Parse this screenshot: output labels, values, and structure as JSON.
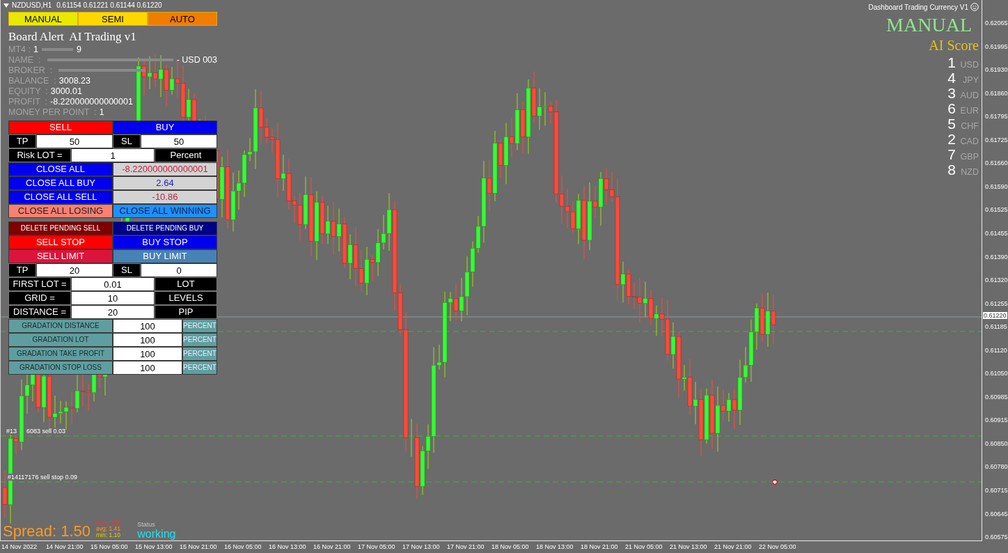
{
  "chart_header": {
    "symbol": "NZDUSD,H1",
    "quotes": "0.61154 0.61221 0.61144 0.61220"
  },
  "modes": [
    {
      "label": "MANUAL",
      "color": "#e8e800"
    },
    {
      "label": "SEMI",
      "color": "#ffd700"
    },
    {
      "label": "AUTO",
      "color": "#ee7d00"
    }
  ],
  "title": "Board Alert  AI Trading v1",
  "account": [
    {
      "label": "MT4 :",
      "prefix": "1",
      "redacted": true,
      "value": "9"
    },
    {
      "label": "NAME  :",
      "redacted": true,
      "value": "- USD 003"
    },
    {
      "label": "BROKER  :",
      "redacted": true
    },
    {
      "label": "BALANCE  :",
      "value": "3008.23"
    },
    {
      "label": "EQUITY  :",
      "value": "3000.01"
    },
    {
      "label": "PROFIT  :",
      "value": "-8.220000000000001"
    },
    {
      "label": "MONEY PER POINT  :",
      "value": "1"
    }
  ],
  "order_panel": [
    {
      "rows": [
        {
          "kind": "pair",
          "left": {
            "kind": "sell",
            "text": "SELL"
          },
          "right": {
            "kind": "buy",
            "text": "BUY"
          }
        },
        {
          "kind": "tp-sl",
          "tp_label": "TP",
          "tp": "50",
          "sl_label": "SL",
          "sl": "50"
        },
        {
          "kind": "setting",
          "label": "Risk LOT =",
          "value": "1",
          "unit": "Percent"
        },
        {
          "kind": "pair",
          "left": {
            "kind": "close",
            "text": "CLOSE ALL"
          },
          "right": {
            "kind": "readout",
            "text": "-8.220000000000001",
            "color": "#c8203c"
          }
        },
        {
          "kind": "pair",
          "left": {
            "kind": "close",
            "text": "CLOSE ALL BUY"
          },
          "right": {
            "kind": "readout",
            "text": "2.64",
            "color": "#2020c0"
          }
        },
        {
          "kind": "pair",
          "left": {
            "kind": "close",
            "text": "CLOSE ALL SELL"
          },
          "right": {
            "kind": "readout",
            "text": "-10.86",
            "color": "#c8203c"
          }
        },
        {
          "kind": "pair",
          "left": {
            "kind": "losing",
            "text": "CLOSE ALL LOSING"
          },
          "right": {
            "kind": "winning",
            "text": "CLOSE ALL WINNING"
          }
        }
      ]
    },
    {
      "rows": [
        {
          "kind": "pair",
          "left": {
            "kind": "delete-sell",
            "text": "DELETE PENDING SELL"
          },
          "right": {
            "kind": "delete-buy",
            "text": "DELETE PENDING BUY"
          }
        },
        {
          "kind": "pair",
          "left": {
            "kind": "sell",
            "text": "SELL STOP"
          },
          "right": {
            "kind": "buy",
            "text": "BUY STOP"
          }
        },
        {
          "kind": "pair",
          "left": {
            "kind": "sell-limit",
            "text": "SELL LIMIT"
          },
          "right": {
            "kind": "buy-limit",
            "text": "BUY LIMIT"
          }
        },
        {
          "kind": "tp-sl",
          "tp_label": "TP",
          "tp": "20",
          "sl_label": "SL",
          "sl": "0"
        },
        {
          "kind": "setting",
          "label": "FIRST LOT =",
          "value": "0.01",
          "unit": "LOT"
        },
        {
          "kind": "setting",
          "label": "GRID =",
          "value": "10",
          "unit": "LEVELS"
        },
        {
          "kind": "setting",
          "label": "DISTANCE =",
          "value": "20",
          "unit": "PIP"
        },
        {
          "kind": "gradation",
          "label": "GRADATION DISTANCE",
          "value": "100",
          "unit": "PERCENT"
        },
        {
          "kind": "gradation",
          "label": "GRADATION LOT",
          "value": "100",
          "unit": "PERCENT"
        },
        {
          "kind": "gradation",
          "label": "GRADATION TAKE PROFIT",
          "value": "100",
          "unit": "PERCENT"
        },
        {
          "kind": "gradation",
          "label": "GRADATION STOP LOSS",
          "value": "100",
          "unit": "PERCENT"
        }
      ]
    }
  ],
  "dashboard": {
    "title": "Dashboard Trading Currency V1",
    "mode": "MANUAL",
    "score_title": "AI Score",
    "scores": [
      {
        "rank": "1",
        "currency": "USD"
      },
      {
        "rank": "4",
        "currency": "JPY"
      },
      {
        "rank": "3",
        "currency": "AUD"
      },
      {
        "rank": "6",
        "currency": "EUR"
      },
      {
        "rank": "5",
        "currency": "CHF"
      },
      {
        "rank": "2",
        "currency": "CAD"
      },
      {
        "rank": "7",
        "currency": "GBP"
      },
      {
        "rank": "8",
        "currency": "NZD"
      }
    ]
  },
  "order_lines": [
    {
      "prefix": "#13",
      "text": "6083 sell 0.03"
    },
    {
      "text": "#14117176 sell stop 0.09"
    }
  ],
  "spread": {
    "label": "Spread: 1.50",
    "max": "max: 1.60",
    "avg": "avg: 1.41",
    "min": "min: 1.10",
    "status_label": "Status",
    "status": "working"
  },
  "price_axis": [
    "0.62065",
    "0.61995",
    "0.61930",
    "0.61860",
    "0.61795",
    "0.61725",
    "0.61660",
    "0.61590",
    "0.61525",
    "0.61455",
    "0.61390",
    "0.61320",
    "0.61255",
    "0.61185",
    "0.61120",
    "0.61050",
    "0.60985",
    "0.60915",
    "0.60850",
    "0.60780",
    "0.60715",
    "0.60645",
    "0.60575"
  ],
  "current_price": "0.61220",
  "time_axis": [
    "14 Nov 2022",
    "14 Nov 21:00",
    "15 Nov 05:00",
    "15 Nov 13:00",
    "15 Nov 21:00",
    "16 Nov 05:00",
    "16 Nov 13:00",
    "16 Nov 21:00",
    "17 Nov 05:00",
    "17 Nov 13:00",
    "17 Nov 21:00",
    "18 Nov 05:00",
    "18 Nov 13:00",
    "18 Nov 21:00",
    "21 Nov 05:00",
    "21 Nov 13:00",
    "21 Nov 21:00",
    "22 Nov 05:00"
  ]
}
